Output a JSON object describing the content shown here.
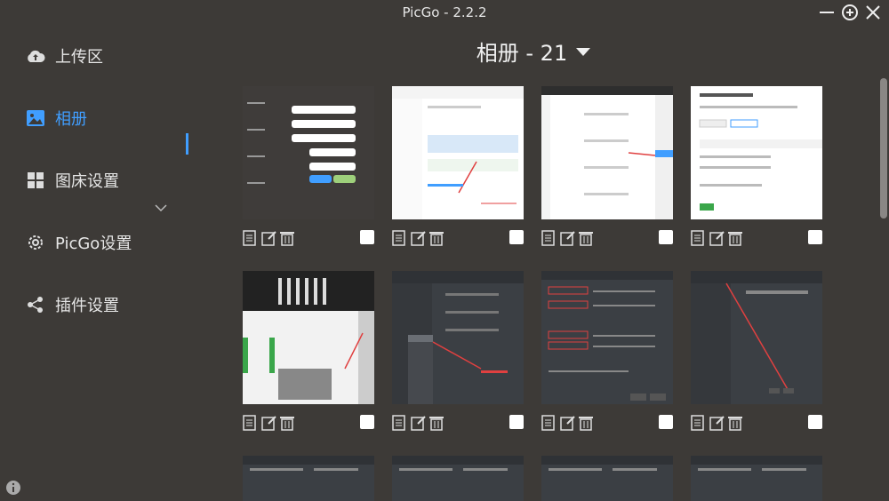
{
  "window": {
    "title": "PicGo - 2.2.2"
  },
  "sidebar": {
    "items": [
      {
        "label": "上传区",
        "icon": "cloud-upload-icon"
      },
      {
        "label": "相册",
        "icon": "image-icon",
        "active": true
      },
      {
        "label": "图床设置",
        "icon": "grid-icon"
      },
      {
        "label": "PicGo设置",
        "icon": "gear-icon"
      },
      {
        "label": "插件设置",
        "icon": "share-icon"
      }
    ]
  },
  "gallery": {
    "title": "相册 - 21",
    "rows": 3,
    "columns": 4
  },
  "colors": {
    "accent": "#409eff",
    "background": "#3d3a37"
  }
}
